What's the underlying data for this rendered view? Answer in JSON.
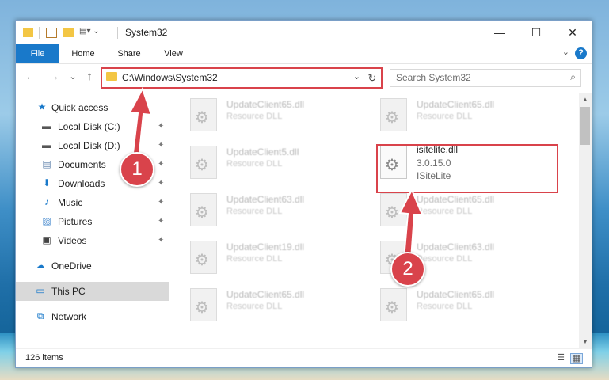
{
  "titlebar": {
    "title": "System32",
    "minimize": "—",
    "maximize": "☐",
    "close": "✕"
  },
  "ribbon": {
    "tabs": [
      "File",
      "Home",
      "Share",
      "View"
    ],
    "help": "?",
    "expand": "⌄"
  },
  "nav": {
    "back": "←",
    "forward": "→",
    "recent": "⌄",
    "up": "↑",
    "address": "C:\\Windows\\System32",
    "address_dropdown": "⌄",
    "refresh": "↻",
    "search_placeholder": "Search System32",
    "search_icon": "⌕"
  },
  "sidebar": {
    "items": [
      {
        "label": "Quick access",
        "icon": "star-icon",
        "glyph": "★",
        "color": "#1979ca"
      },
      {
        "label": "Local Disk (C:)",
        "icon": "drive-icon",
        "glyph": "▬",
        "color": "#555555",
        "pinned": true
      },
      {
        "label": "Local Disk (D:)",
        "icon": "drive-icon",
        "glyph": "▬",
        "color": "#555555",
        "pinned": true
      },
      {
        "label": "Documents",
        "icon": "document-icon",
        "glyph": "▤",
        "color": "#5a7ea8",
        "pinned": true
      },
      {
        "label": "Downloads",
        "icon": "download-icon",
        "glyph": "⬇",
        "color": "#1979ca",
        "pinned": true
      },
      {
        "label": "Music",
        "icon": "music-icon",
        "glyph": "♪",
        "color": "#1979ca",
        "pinned": true
      },
      {
        "label": "Pictures",
        "icon": "pictures-icon",
        "glyph": "▨",
        "color": "#4a8ccf",
        "pinned": true
      },
      {
        "label": "Videos",
        "icon": "videos-icon",
        "glyph": "▣",
        "color": "#444444",
        "pinned": true
      },
      {
        "label": "OneDrive",
        "icon": "cloud-icon",
        "glyph": "☁",
        "color": "#1979ca"
      },
      {
        "label": "This PC",
        "icon": "computer-icon",
        "glyph": "▭",
        "color": "#1979ca"
      },
      {
        "label": "Network",
        "icon": "network-icon",
        "glyph": "⧉",
        "color": "#1979ca"
      }
    ],
    "pin_glyph": "📌"
  },
  "files": [
    {
      "name": "UpdateClient65.dll",
      "desc": "Resource DLL"
    },
    {
      "name": "UpdateClient65.dll",
      "desc": "Resource DLL"
    },
    {
      "name": "UpdateClient5.dll",
      "desc": "Resource DLL"
    },
    {
      "name": "isitelite.dll",
      "desc": "3.0.15.0",
      "desc2": "ISiteLite"
    },
    {
      "name": "UpdateClient63.dll",
      "desc": "Resource DLL"
    },
    {
      "name": "UpdateClient65.dll",
      "desc": "Resource DLL"
    },
    {
      "name": "UpdateClient19.dll",
      "desc": "Resource DLL"
    },
    {
      "name": "UpdateClient63.dll",
      "desc": "Resource DLL"
    },
    {
      "name": "UpdateClient65.dll",
      "desc": "Resource DLL"
    },
    {
      "name": "UpdateClient65.dll",
      "desc": "Resource DLL"
    }
  ],
  "status": {
    "count": "126 items"
  },
  "annotations": {
    "step1": "1",
    "step2": "2",
    "color": "#d9434b"
  }
}
